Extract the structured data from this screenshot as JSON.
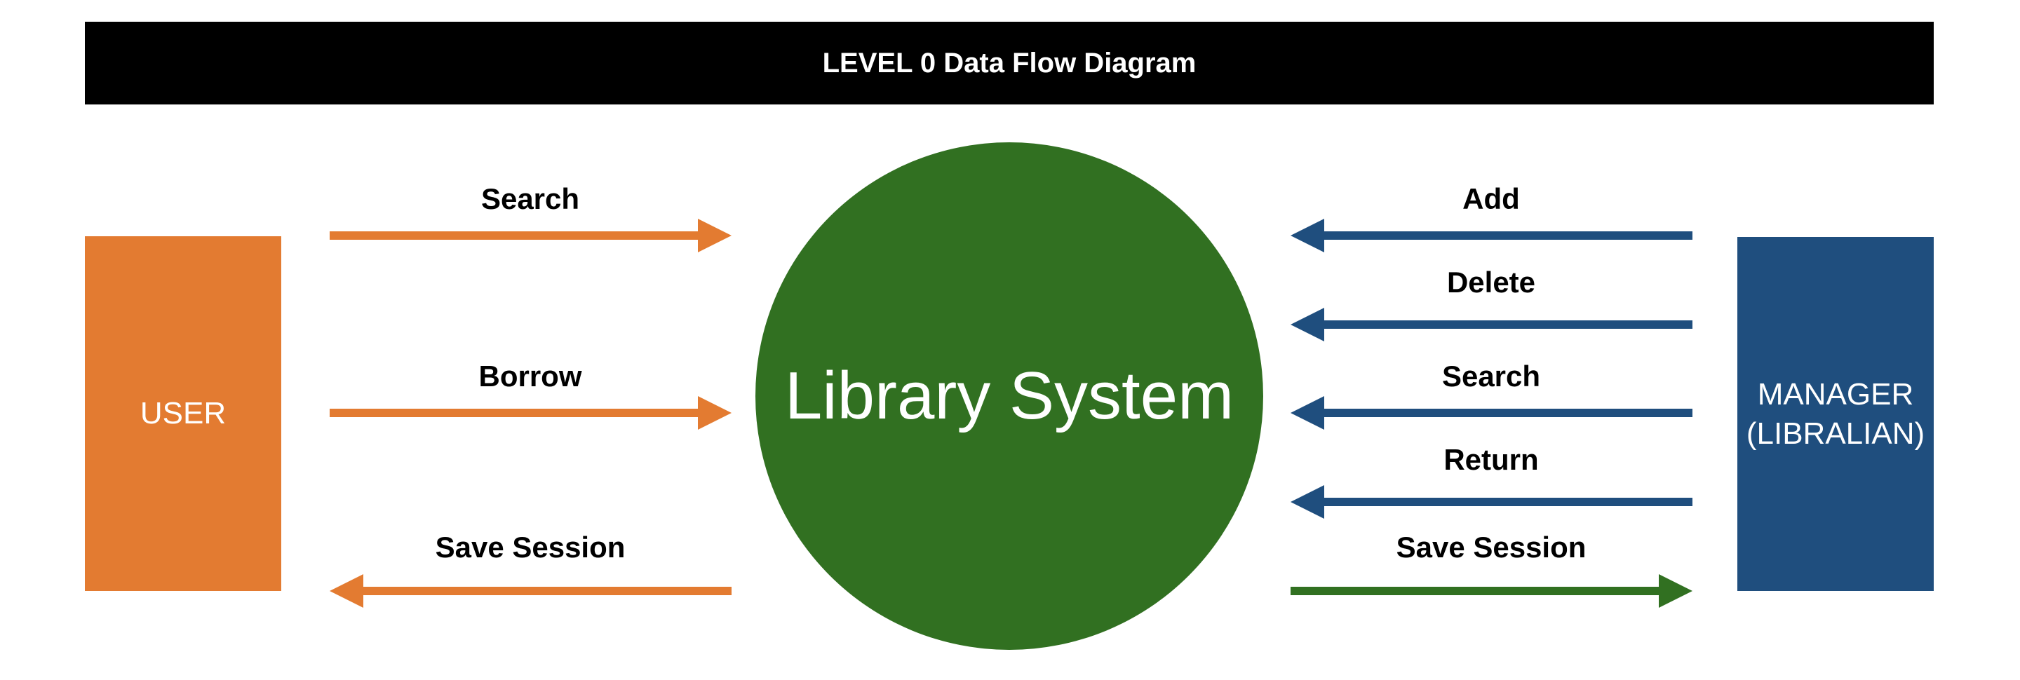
{
  "diagram": {
    "title": "LEVEL 0 Data Flow Diagram",
    "process": {
      "label": "Library System"
    },
    "entities": {
      "user": {
        "label": "USER"
      },
      "manager": {
        "label_line1": "MANAGER",
        "label_line2": "(LIBRALIAN)"
      }
    },
    "flows": {
      "user_search": "Search",
      "user_borrow": "Borrow",
      "user_save_session": "Save Session",
      "manager_add": "Add",
      "manager_delete": "Delete",
      "manager_search": "Search",
      "manager_return": "Return",
      "manager_save_session": "Save Session"
    }
  },
  "colors": {
    "banner": "#000000",
    "user": "#E37B31",
    "manager": "#1F4E7E",
    "process": "#317021",
    "save_session_out": "#317021"
  }
}
